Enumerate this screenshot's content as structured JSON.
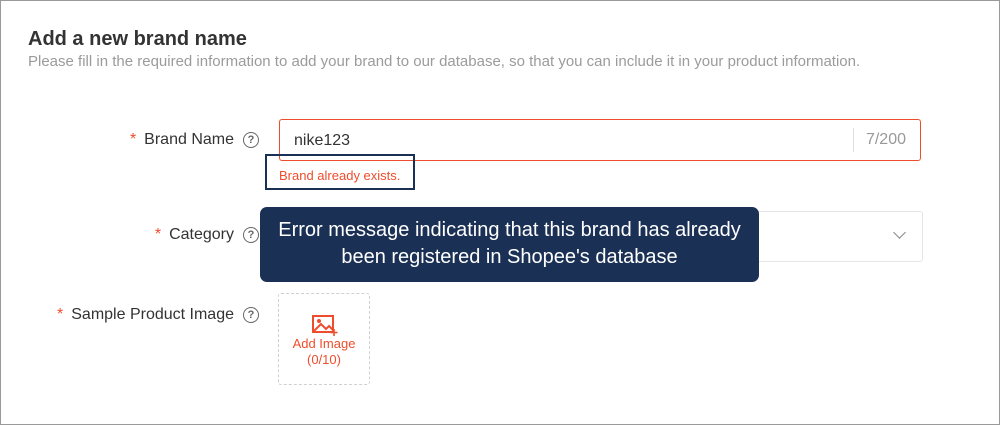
{
  "header": {
    "title": "Add a new brand name",
    "subtitle": "Please fill in the required information to add your brand to our database, so that you can include it in your product information."
  },
  "form": {
    "required_marker": "*",
    "help_glyph": "?",
    "brand_name": {
      "label": "Brand Name",
      "value": "nike123",
      "counter": "7/200",
      "error": "Brand already exists."
    },
    "category": {
      "label": "Category"
    },
    "sample_image": {
      "label": "Sample Product Image",
      "add_label": "Add Image",
      "count": "(0/10)"
    }
  },
  "annotation": {
    "callout_text": "Error message indicating that this brand has already been registered in Shopee's database"
  },
  "colors": {
    "accent": "#ee4d2d",
    "callout_bg": "#1b3055",
    "subtitle": "#9b9b9b"
  }
}
